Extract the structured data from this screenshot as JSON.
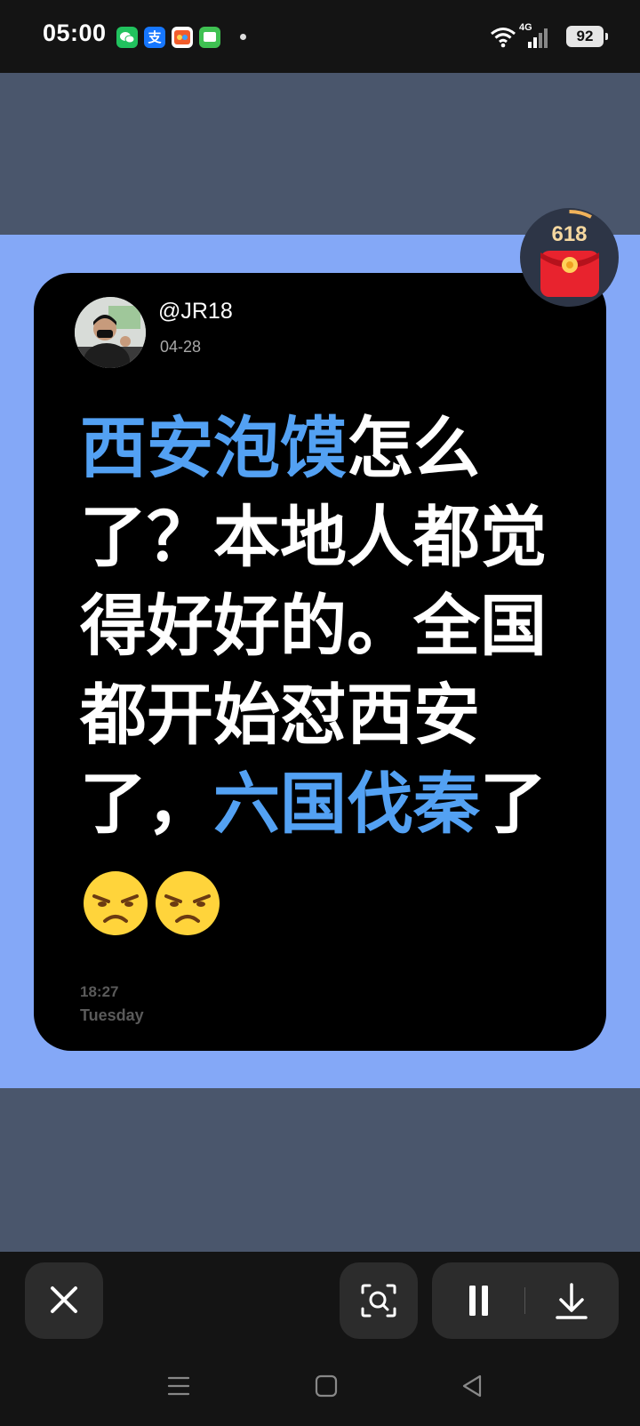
{
  "status_bar": {
    "time": "05:00",
    "notification_icons": [
      "wechat-icon",
      "alipay-icon",
      "game-icon",
      "messages-icon"
    ],
    "network": "4G",
    "battery": "92"
  },
  "promo": {
    "label": "618",
    "icon": "red-envelope-icon"
  },
  "post": {
    "username": "@JR18",
    "date": "04-28",
    "lines": [
      {
        "highlight": "西安泡馍",
        "rest": "怎么"
      },
      {
        "text": "了？本地人都觉"
      },
      {
        "text": "得好好的。全国"
      },
      {
        "text": "都开始怼西安"
      },
      {
        "before": "了，",
        "highlight": "六国伐秦",
        "after": "了"
      }
    ],
    "emojis": [
      "annoyed-face-icon",
      "annoyed-face-icon"
    ],
    "time": "18:27",
    "day": "Tuesday",
    "colors": {
      "text": "#ffffff",
      "highlight": "#53a1f3",
      "card": "#000000",
      "backdrop": "#84a8f7"
    }
  },
  "toolbar": {
    "close": "close-icon",
    "scan": "image-search-icon",
    "pause": "pause-icon",
    "download": "download-icon"
  },
  "nav_bar": {
    "menu": "menu-icon",
    "home": "home-icon",
    "back": "back-icon"
  }
}
